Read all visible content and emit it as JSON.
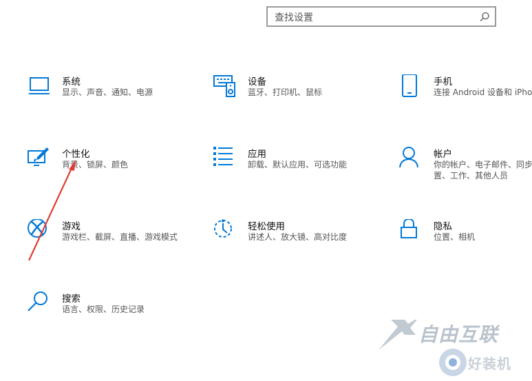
{
  "search": {
    "placeholder": "查找设置",
    "icon": "search-icon"
  },
  "tiles": [
    {
      "title": "系统",
      "desc": "显示、声音、通知、电源",
      "icon": "laptop-icon"
    },
    {
      "title": "设备",
      "desc": "蓝牙、打印机、鼠标",
      "icon": "devices-icon"
    },
    {
      "title": "手机",
      "desc": "连接 Android 设备和 iPho",
      "icon": "phone-icon"
    },
    {
      "title": "个性化",
      "desc": "背景、锁屏、颜色",
      "icon": "personalization-icon"
    },
    {
      "title": "应用",
      "desc": "卸载、默认应用、可选功能",
      "icon": "apps-icon"
    },
    {
      "title": "帐户",
      "desc": "你的帐户、电子邮件、同步设",
      "desc2": "置、工作、其他人员",
      "icon": "person-icon"
    },
    {
      "title": "游戏",
      "desc": "游戏栏、截屏、直播、游戏模式",
      "icon": "xbox-icon"
    },
    {
      "title": "轻松使用",
      "desc": "讲述人、放大镜、高对比度",
      "icon": "ease-of-access-icon"
    },
    {
      "title": "隐私",
      "desc": "位置、相机",
      "icon": "lock-icon"
    },
    {
      "title": "搜索",
      "desc": "语言、权限、历史记录",
      "icon": "search-icon"
    }
  ],
  "watermark": {
    "line1": "自由互联",
    "line2": "好装机"
  },
  "colors": {
    "accent": "#0078d7",
    "annotation": "#e03c31"
  }
}
